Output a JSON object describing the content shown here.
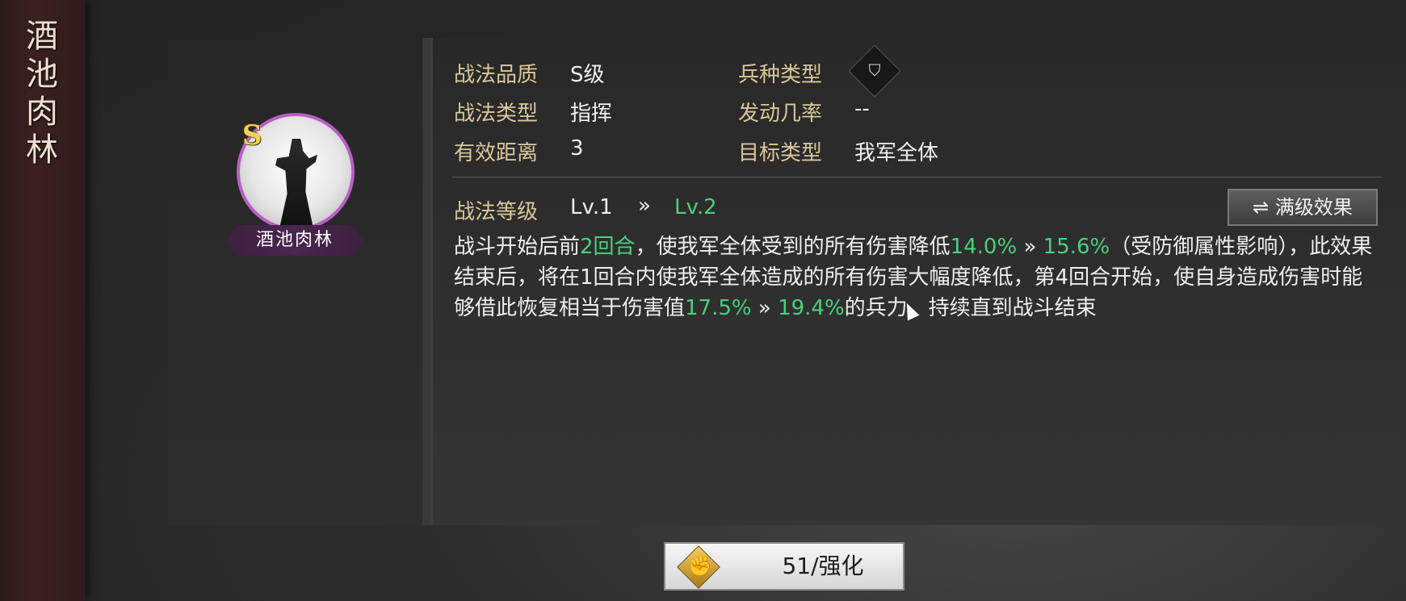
{
  "banner": {
    "title_chars": [
      "酒",
      "池",
      "肉",
      "林"
    ]
  },
  "skill": {
    "grade": "S",
    "name": "酒池肉林",
    "accent_color": "#b85fc4"
  },
  "stats": {
    "quality_label": "战法品质",
    "quality_value": "S级",
    "troop_label": "兵种类型",
    "troop_icon": "troop-type-icon",
    "type_label": "战法类型",
    "type_value": "指挥",
    "rate_label": "发动几率",
    "rate_value": "--",
    "range_label": "有效距离",
    "range_value": "3",
    "target_label": "目标类型",
    "target_value": "我军全体"
  },
  "level": {
    "label": "战法等级",
    "current": "Lv.1",
    "arrow": "»",
    "next": "Lv.2",
    "max_button": "满级效果",
    "max_button_icon": "⇌"
  },
  "description": {
    "p1": "战斗开始后前",
    "v1": "2回合",
    "p2": "，使我军全体受到的所有伤害降低",
    "v2": "14.0%",
    "arrow1": " » ",
    "v3": "15.6%",
    "p3": "（受防御属性影响），此效果结束后，将在1回合内使我军全体造成的所有伤害大幅度降低，第4回合开始，使自身造成伤害时能够借此恢复相当于伤害值",
    "v4": "17.5%",
    "arrow2": " » ",
    "v5": "19.4%",
    "p4": "的兵力，持续直到战斗结束",
    "highlight_color": "#48d17c"
  },
  "enhance": {
    "label": "51/强化",
    "icon": "fist-icon"
  }
}
